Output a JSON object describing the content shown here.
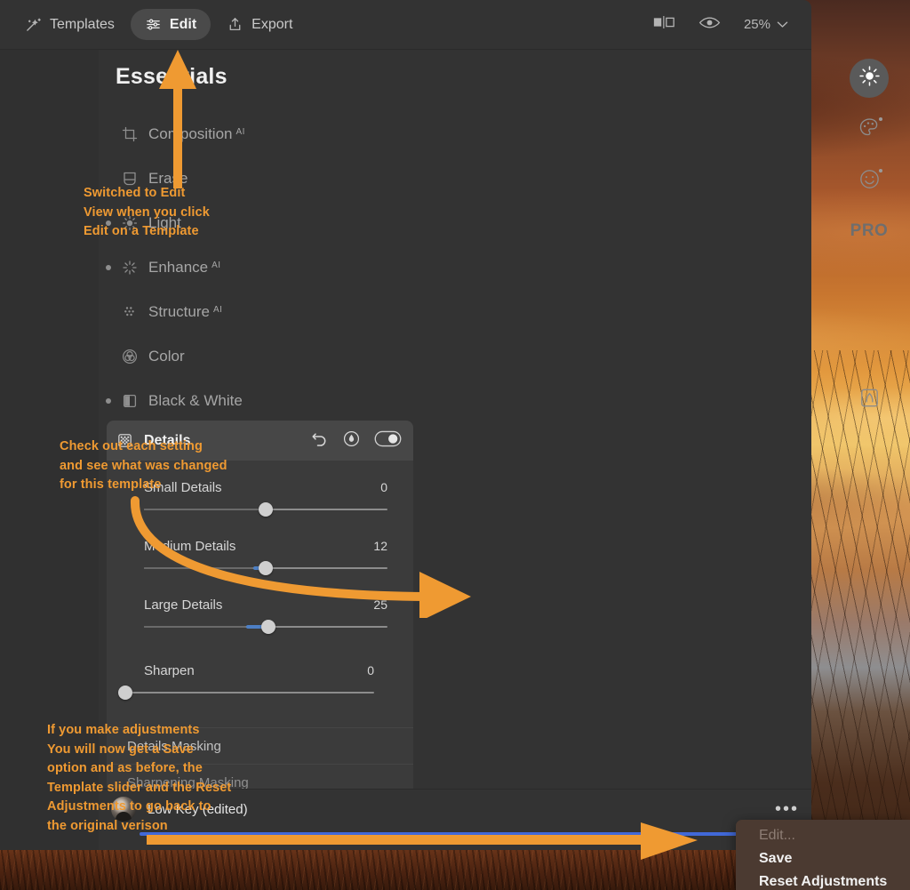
{
  "topbar": {
    "tabs": [
      {
        "label": "Templates",
        "icon": "magic-wand-icon",
        "active": false
      },
      {
        "label": "Edit",
        "icon": "sliders-icon",
        "active": true
      },
      {
        "label": "Export",
        "icon": "share-icon",
        "active": false
      }
    ],
    "compare_icon": "before-after-icon",
    "preview_icon": "eye-icon",
    "zoom_value": "25%",
    "zoom_chevron": "chevron-down-icon"
  },
  "panel": {
    "title": "Essentials",
    "tools": [
      {
        "label": "Composition",
        "sup": "AI",
        "icon": "crop-icon",
        "dot": false
      },
      {
        "label": "Erase",
        "sup": "",
        "icon": "eraser-icon",
        "dot": false
      },
      {
        "label": "Light",
        "sup": "",
        "icon": "sun-small-icon",
        "dot": true
      },
      {
        "label": "Enhance",
        "sup": "AI",
        "icon": "sparkle-icon",
        "dot": true
      },
      {
        "label": "Structure",
        "sup": "AI",
        "icon": "dots-grid-icon",
        "dot": false
      },
      {
        "label": "Color",
        "sup": "",
        "icon": "color-wheel-icon",
        "dot": false
      },
      {
        "label": "Black & White",
        "sup": "",
        "icon": "halftone-square-icon",
        "dot": true
      }
    ]
  },
  "details": {
    "title": "Details",
    "header_icon": "details-grid-icon",
    "actions": [
      {
        "name": "reset-icon",
        "label": "Undo"
      },
      {
        "name": "masking-icon",
        "label": "Masking"
      },
      {
        "name": "toggle-on-icon",
        "label": "Enabled"
      }
    ],
    "sliders": [
      {
        "name": "Small Details",
        "value": "0",
        "pos_pct": 50,
        "fill_from_pct": 50,
        "fill_to_pct": 50
      },
      {
        "name": "Medium Details",
        "value": "12",
        "pos_pct": 50,
        "fill_from_pct": 45,
        "fill_to_pct": 50
      },
      {
        "name": "Large Details",
        "value": "25",
        "pos_pct": 50,
        "fill_from_pct": 42,
        "fill_to_pct": 50
      },
      {
        "name": "Sharpen",
        "value": "0",
        "pos_pct": 2,
        "fill_from_pct": 0,
        "fill_to_pct": 0
      }
    ],
    "sub_rows": [
      {
        "label": "Details Masking",
        "dim": false
      },
      {
        "label": "Sharpening Masking",
        "dim": true
      }
    ]
  },
  "template_bar": {
    "name": "Low Key (edited)",
    "thumb": "portrait-thumbnail",
    "more_icon": "ellipsis-icon",
    "slider_value_pct": 100
  },
  "context_menu": {
    "items": [
      {
        "label": "Edit...",
        "disabled": true
      },
      {
        "label": "Save",
        "disabled": false
      },
      {
        "label": "Reset Adjustments",
        "disabled": false
      }
    ]
  },
  "rail": {
    "items": [
      {
        "name": "essentials-sun-icon",
        "label": "Essentials",
        "active": true,
        "badge": false,
        "type": "icon"
      },
      {
        "name": "creative-palette-icon",
        "label": "Creative",
        "active": false,
        "badge": true,
        "type": "icon"
      },
      {
        "name": "portrait-smiley-icon",
        "label": "Portrait",
        "active": false,
        "badge": true,
        "type": "icon"
      },
      {
        "name": "pro-label",
        "label": "PRO",
        "active": false,
        "badge": false,
        "type": "text"
      },
      {
        "name": "presets-a-icon",
        "label": "Presets",
        "active": false,
        "badge": false,
        "type": "icon"
      }
    ]
  },
  "annotations": [
    {
      "id": "a1",
      "text": "Switched to Edit\nView when you click\nEdit on a Template"
    },
    {
      "id": "a2",
      "text": "Check out each setting\nand see what was changed\nfor this template"
    },
    {
      "id": "a3",
      "text": "If you make adjustments\nYou will now get a Save\noption and as before, the\nTemplate slider and the Reset\nAdjustments to go back to\nthe original verison"
    }
  ],
  "colors": {
    "annotation": "#ef9a32",
    "accent_blue": "#4169d8",
    "panel_bg": "#333333",
    "card_bg": "#3b3b3b"
  }
}
